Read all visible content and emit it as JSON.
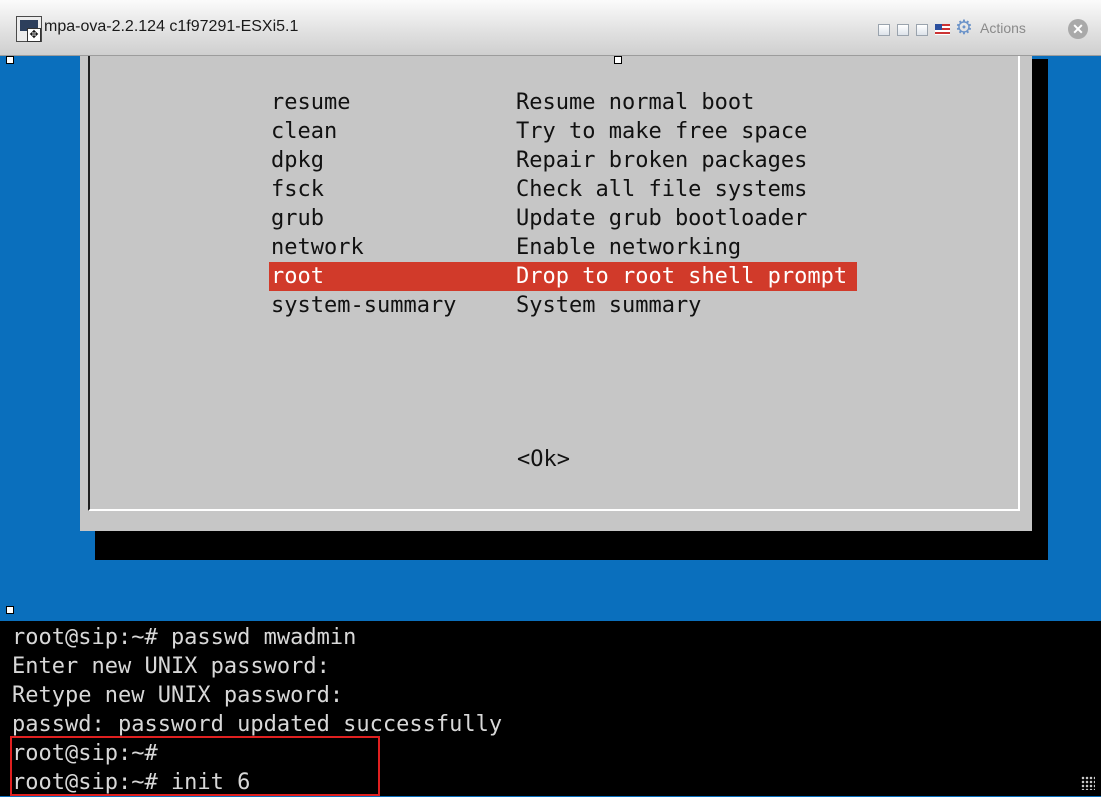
{
  "window": {
    "title": "mpa-ova-2.2.124 c1f97291-ESXi5.1",
    "actions_label": "Actions",
    "close_glyph": "✕",
    "gear_glyph": "⚙",
    "move_glyph": "✥"
  },
  "recovery_menu": {
    "items": [
      {
        "tag": "resume",
        "desc": "Resume normal boot"
      },
      {
        "tag": "clean",
        "desc": "Try to make free space"
      },
      {
        "tag": "dpkg",
        "desc": "Repair broken packages"
      },
      {
        "tag": "fsck",
        "desc": "Check all file systems"
      },
      {
        "tag": "grub",
        "desc": "Update grub bootloader"
      },
      {
        "tag": "network",
        "desc": "Enable networking"
      },
      {
        "tag": "root",
        "desc": "Drop to root shell prompt"
      },
      {
        "tag": "system-summary",
        "desc": "System summary"
      }
    ],
    "selected": "root",
    "ok_label": "<Ok>"
  },
  "terminal": {
    "lines": [
      "root@sip:~# passwd mwadmin",
      "Enter new UNIX password:",
      "Retype new UNIX password:",
      "passwd: password updated successfully",
      "root@sip:~#",
      "root@sip:~# init 6"
    ]
  },
  "colors": {
    "console_bg": "#0a6fbd",
    "dialog_bg": "#c6c6c6",
    "selection": "#d13a2a",
    "annotation_box": "#e02020"
  },
  "icons": [
    "vm-console-icon",
    "move-icon",
    "minimize-icon",
    "restore-icon",
    "maximize-icon",
    "us-flag-icon",
    "gear-icon",
    "close-icon",
    "resize-grip-icon"
  ]
}
